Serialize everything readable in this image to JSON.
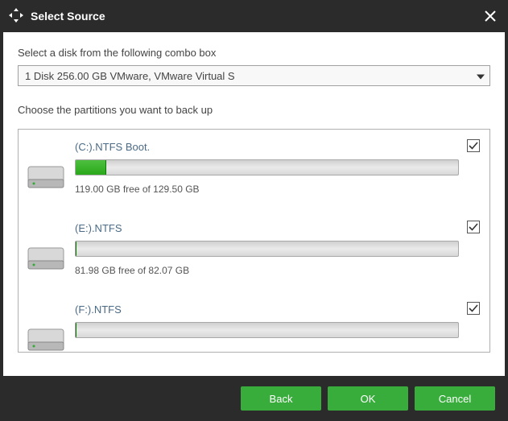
{
  "title": "Select Source",
  "labels": {
    "disk_prompt": "Select a disk from the following combo box",
    "partition_prompt": "Choose the partitions you want to back up"
  },
  "combo": {
    "selected": "1 Disk 256.00 GB VMware,  VMware Virtual S"
  },
  "partitions": [
    {
      "title": "(C:).NTFS Boot.",
      "free_text": "119.00 GB free of 129.50 GB",
      "used_pct": 8,
      "checked": true
    },
    {
      "title": "(E:).NTFS",
      "free_text": "81.98 GB free of 82.07 GB",
      "used_pct": 0.1,
      "checked": true
    },
    {
      "title": "(F:).NTFS",
      "free_text": "",
      "used_pct": 0,
      "checked": true
    }
  ],
  "buttons": {
    "back": "Back",
    "ok": "OK",
    "cancel": "Cancel"
  }
}
